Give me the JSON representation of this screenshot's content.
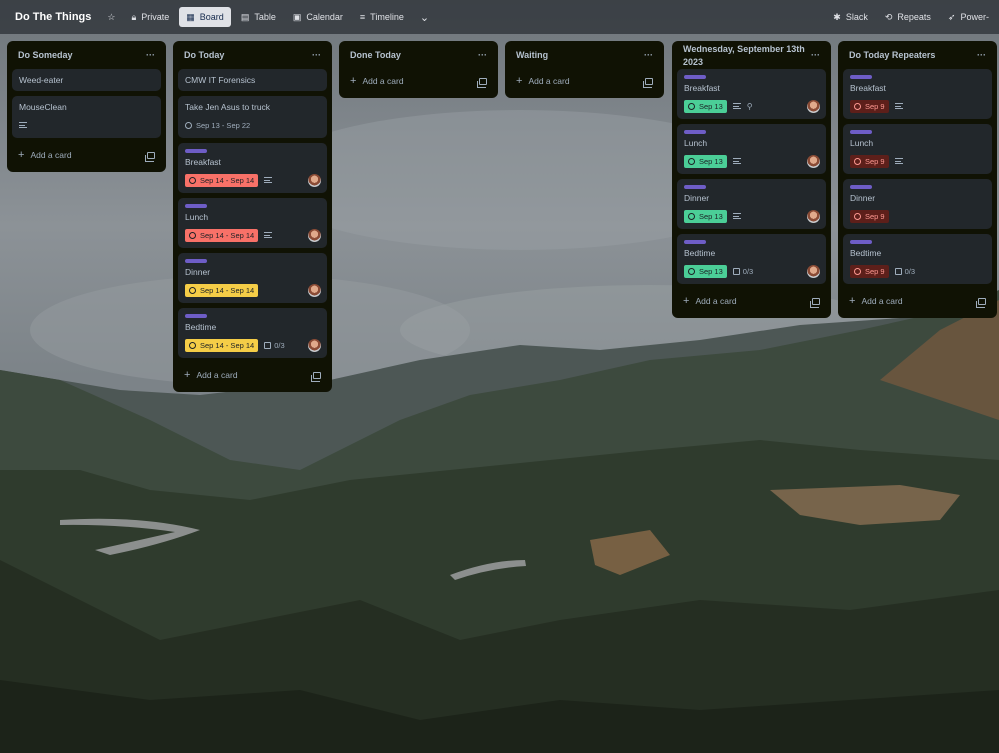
{
  "topbar": {
    "board_title": "Do The Things",
    "private_label": "Private",
    "board_label": "Board",
    "table_label": "Table",
    "calendar_label": "Calendar",
    "timeline_label": "Timeline",
    "slack_label": "Slack",
    "repeats_label": "Repeats",
    "powerups_label": "Power-"
  },
  "add_card_label": "Add a card",
  "lists": [
    {
      "title": "Do Someday",
      "cards": [
        {
          "title": "Weed-eater"
        },
        {
          "title": "MouseClean",
          "has_description": true
        }
      ]
    },
    {
      "title": "Do Today",
      "cards": [
        {
          "title": "CMW IT Forensics"
        },
        {
          "title": "Take Jen Asus to truck",
          "due": "Sep 13 - Sep 22",
          "due_style": "plain"
        },
        {
          "title": "Breakfast",
          "label_color": "#6e5dc6",
          "due": "Sep 14 - Sep 14",
          "due_style": "red",
          "has_description": true,
          "avatar": true
        },
        {
          "title": "Lunch",
          "label_color": "#6e5dc6",
          "due": "Sep 14 - Sep 14",
          "due_style": "red",
          "has_description": true,
          "avatar": true
        },
        {
          "title": "Dinner",
          "label_color": "#6e5dc6",
          "due": "Sep 14 - Sep 14",
          "due_style": "yellow",
          "avatar": true
        },
        {
          "title": "Bedtime",
          "label_color": "#6e5dc6",
          "due": "Sep 14 - Sep 14",
          "due_style": "yellow",
          "checklist": "0/3",
          "avatar": true
        }
      ]
    },
    {
      "title": "Done Today",
      "cards": []
    },
    {
      "title": "Waiting",
      "cards": []
    },
    {
      "title": "Wednesday, September 13th 2023",
      "cards": [
        {
          "title": "Breakfast",
          "label_color": "#6e5dc6",
          "due": "Sep 13",
          "due_style": "green",
          "has_description": true,
          "location": true,
          "avatar": true
        },
        {
          "title": "Lunch",
          "label_color": "#6e5dc6",
          "due": "Sep 13",
          "due_style": "green",
          "has_description": true,
          "avatar": true
        },
        {
          "title": "Dinner",
          "label_color": "#6e5dc6",
          "due": "Sep 13",
          "due_style": "green",
          "has_description": true,
          "avatar": true
        },
        {
          "title": "Bedtime",
          "label_color": "#6e5dc6",
          "due": "Sep 13",
          "due_style": "green",
          "checklist": "0/3",
          "avatar": true
        }
      ]
    },
    {
      "title": "Do Today Repeaters",
      "cards": [
        {
          "title": "Breakfast",
          "label_color": "#6e5dc6",
          "due": "Sep 9",
          "due_style": "darkred",
          "has_description": true
        },
        {
          "title": "Lunch",
          "label_color": "#6e5dc6",
          "due": "Sep 9",
          "due_style": "darkred",
          "has_description": true
        },
        {
          "title": "Dinner",
          "label_color": "#6e5dc6",
          "due": "Sep 9",
          "due_style": "darkred"
        },
        {
          "title": "Bedtime",
          "label_color": "#6e5dc6",
          "due": "Sep 9",
          "due_style": "darkred",
          "checklist": "0/3"
        }
      ]
    }
  ]
}
